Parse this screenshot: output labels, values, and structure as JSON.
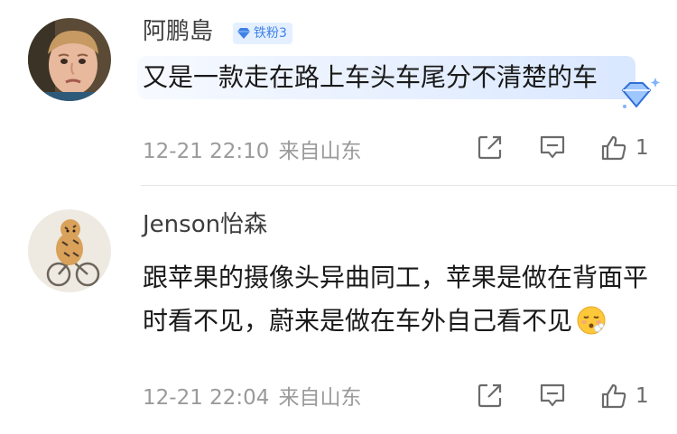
{
  "comments": [
    {
      "username": "阿鹏島",
      "badge": "铁粉3",
      "text": "又是一款走在路上车头车尾分不清楚的车",
      "time": "12-21 22:10",
      "location": "来自山东",
      "likes": "1",
      "avatar_icon": "boy-avatar"
    },
    {
      "username": "Jenson怡森",
      "text": "跟苹果的摄像头异曲同工，苹果是做在背面平时看不见，蔚来是做在车外自己看不见",
      "emoji": "face-exhaling-emoji",
      "time": "12-21 22:04",
      "location": "来自山东",
      "likes": "1",
      "avatar_icon": "tiger-painting-avatar"
    }
  ],
  "colors": {
    "badge_blue": "#3f82e6",
    "badge_bg": "#e4f0ff",
    "meta_gray": "#9a9a9a"
  }
}
